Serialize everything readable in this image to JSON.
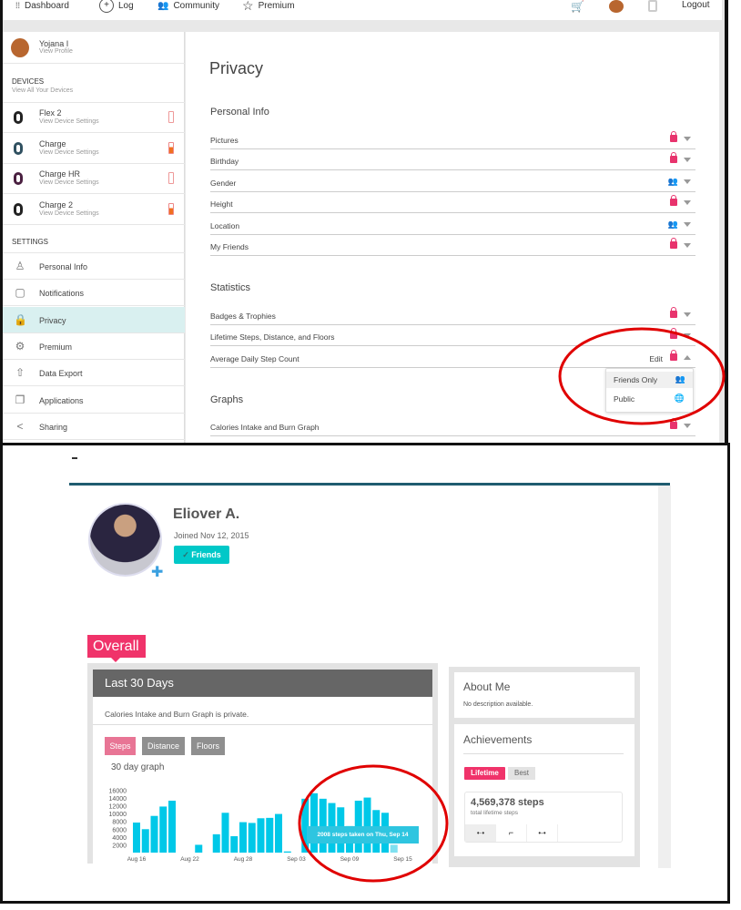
{
  "nav": {
    "items": [
      {
        "label": "Dashboard",
        "icon": "fitbit-logo-icon"
      },
      {
        "label": "Log",
        "icon": "plus-circle-icon"
      },
      {
        "label": "Community",
        "icon": "people-icon"
      },
      {
        "label": "Premium",
        "icon": "star-icon"
      }
    ],
    "logout": "Logout",
    "cart_icon": "cart-icon",
    "tracker_icon": "watch-icon"
  },
  "profile": {
    "name": "Yojana I",
    "link": "View Profile"
  },
  "devices": {
    "heading": "DEVICES",
    "link": "View All Your Devices",
    "items": [
      {
        "name": "Flex 2",
        "sub": "View Device Settings",
        "battery": "empty",
        "band": "#222222"
      },
      {
        "name": "Charge",
        "sub": "View Device Settings",
        "battery": "medium",
        "band": "#2f5060"
      },
      {
        "name": "Charge HR",
        "sub": "View Device Settings",
        "battery": "empty",
        "band": "#4a2040"
      },
      {
        "name": "Charge 2",
        "sub": "View Device Settings",
        "battery": "medium",
        "band": "#222222"
      }
    ]
  },
  "settings": {
    "heading": "SETTINGS",
    "items": [
      {
        "label": "Personal Info",
        "icon": "person-icon"
      },
      {
        "label": "Notifications",
        "icon": "notification-icon"
      },
      {
        "label": "Privacy",
        "icon": "lock-icon",
        "active": true
      },
      {
        "label": "Premium",
        "icon": "gear-icon"
      },
      {
        "label": "Data Export",
        "icon": "export-icon"
      },
      {
        "label": "Applications",
        "icon": "applications-icon"
      },
      {
        "label": "Sharing",
        "icon": "share-icon"
      }
    ]
  },
  "privacy": {
    "title": "Privacy",
    "personal": {
      "heading": "Personal Info",
      "rows": [
        {
          "label": "Pictures",
          "level": "private"
        },
        {
          "label": "Birthday",
          "level": "private"
        },
        {
          "label": "Gender",
          "level": "friends"
        },
        {
          "label": "Height",
          "level": "private"
        },
        {
          "label": "Location",
          "level": "friends"
        },
        {
          "label": "My Friends",
          "level": "private"
        }
      ]
    },
    "statistics": {
      "heading": "Statistics",
      "rows": [
        {
          "label": "Badges & Trophies",
          "level": "private"
        },
        {
          "label": "Lifetime Steps, Distance, and Floors",
          "level": "private"
        },
        {
          "label": "Average Daily Step Count",
          "level": "private",
          "edit": "Edit"
        }
      ]
    },
    "dropdown": [
      {
        "label": "Friends Only",
        "icon": "friends-icon"
      },
      {
        "label": "Public",
        "icon": "globe-icon"
      }
    ],
    "graphs": {
      "heading": "Graphs",
      "rows": [
        {
          "label": "Calories Intake and Burn Graph",
          "level": "private"
        }
      ]
    }
  },
  "friend": {
    "name": "Eliover A.",
    "joined": "Joined Nov 12, 2015",
    "friends_button": "Friends"
  },
  "overall": {
    "tag": "Overall",
    "header": "Last 30 Days",
    "private_note": "Calories Intake and Burn Graph is private.",
    "tabs": [
      "Steps",
      "Distance",
      "Floors"
    ],
    "graph_title": "30 day graph",
    "tooltip": "2008 steps taken on Thu, Sep 14"
  },
  "about": {
    "title": "About Me",
    "text": "No description available."
  },
  "achievements": {
    "title": "Achievements",
    "tabs": [
      "Lifetime",
      "Best"
    ],
    "value": "4,569,378",
    "unit": "steps",
    "sub": "total lifetime steps",
    "icons": [
      "steps-icon",
      "floors-icon",
      "distance-icon"
    ]
  },
  "colors": {
    "accent": "#e8336d",
    "bar": "#00c8e8",
    "teal": "#00bfbf",
    "highlight": "#d9f0f0",
    "annotation": "#e00000"
  },
  "chart_data": {
    "type": "bar",
    "title": "30 day graph",
    "yticks": [
      2000,
      4000,
      6000,
      8000,
      10000,
      12000,
      14000,
      16000
    ],
    "ylim": [
      0,
      16000
    ],
    "xtick_labels": [
      "Aug 16",
      "Aug 22",
      "Aug 28",
      "Sep 03",
      "Sep 09",
      "Sep 15"
    ],
    "categories": [
      "Aug 16",
      "Aug 17",
      "Aug 18",
      "Aug 19",
      "Aug 20",
      "Aug 21",
      "Aug 22",
      "Aug 23",
      "Aug 24",
      "Aug 25",
      "Aug 26",
      "Aug 27",
      "Aug 28",
      "Aug 29",
      "Aug 30",
      "Aug 31",
      "Sep 01",
      "Sep 02",
      "Sep 03",
      "Sep 04",
      "Sep 05",
      "Sep 06",
      "Sep 07",
      "Sep 08",
      "Sep 09",
      "Sep 10",
      "Sep 11",
      "Sep 12",
      "Sep 13",
      "Sep 14",
      "Sep 15"
    ],
    "values": [
      7700,
      6000,
      9400,
      11800,
      13300,
      0,
      0,
      2000,
      0,
      4700,
      10200,
      4200,
      7800,
      7600,
      8800,
      8900,
      9900,
      300,
      0,
      13800,
      15200,
      13800,
      12700,
      11600,
      6800,
      13300,
      14100,
      10900,
      10200,
      2008,
      0
    ]
  }
}
